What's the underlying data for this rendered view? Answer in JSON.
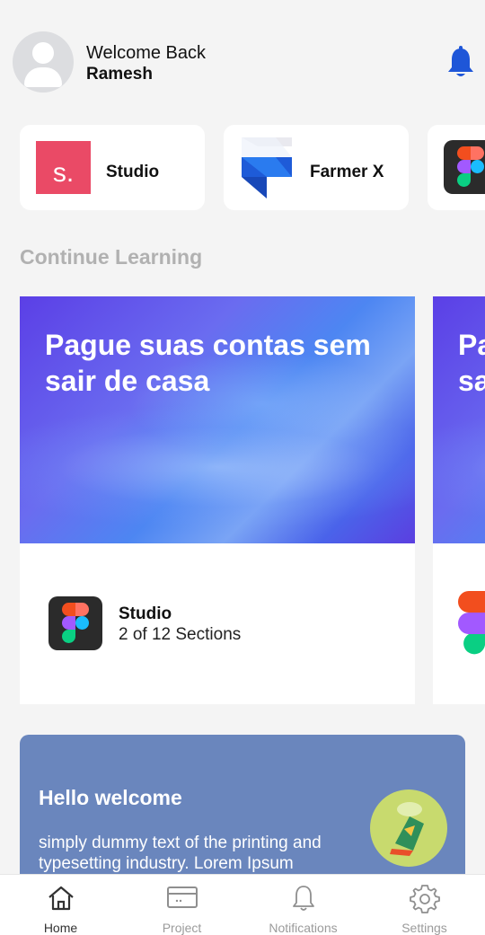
{
  "header": {
    "welcome_text": "Welcome Back",
    "user_name": "Ramesh"
  },
  "apps": [
    {
      "name": "Studio",
      "logo_letter": "s."
    },
    {
      "name": "Farmer X"
    },
    {
      "name": ""
    }
  ],
  "continue_learning": {
    "title": "Continue Learning",
    "courses": [
      {
        "banner_text": "Pague suas contas sem sair de casa",
        "name": "Studio",
        "progress": "2 of 12 Sections"
      },
      {
        "banner_text": "Pague suas contas sem sair de casa"
      }
    ]
  },
  "welcome_card": {
    "title": "Hello welcome",
    "text": "simply dummy text of the printing and typesetting industry. Lorem Ipsum"
  },
  "bottom_nav": [
    {
      "label": "Home",
      "active": true
    },
    {
      "label": "Project",
      "active": false
    },
    {
      "label": "Notifications",
      "active": false
    },
    {
      "label": "Settings",
      "active": false
    }
  ],
  "colors": {
    "accent": "#1e56d8",
    "studio_brand": "#ea4a66",
    "welcome_card_bg": "#6a86bd"
  }
}
